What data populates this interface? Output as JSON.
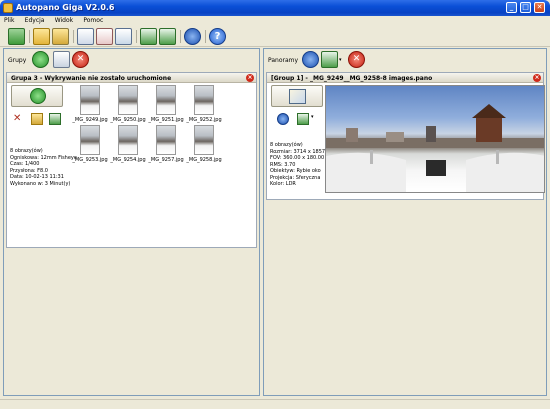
{
  "window": {
    "title": "Autopano Giga V2.0.6"
  },
  "menu": [
    "Plik",
    "Edycja",
    "Widok",
    "Pomoc"
  ],
  "toolbar": {
    "icons": [
      "new-project-icon",
      "open-folder-icon",
      "search-folder-icon",
      "group-icon-1",
      "group-icon-2",
      "group-icon-3",
      "import-icon",
      "export-icon",
      "settings-icon",
      "help-icon"
    ]
  },
  "left_panel": {
    "label": "Grupy",
    "group_title": "Grupa 3 - Wykrywanie nie zostało uruchomione",
    "thumbnails": [
      "_MG_9249.jpg",
      "_MG_9250.jpg",
      "_MG_9251.jpg",
      "_MG_9252.jpg",
      "_MG_9253.jpg",
      "_MG_9254.jpg",
      "_MG_9257.jpg",
      "_MG_9258.jpg"
    ],
    "info": [
      "8 obrazy(ów)",
      "Ogniskowa: 12mm Fisheye",
      "Czas: 1/400",
      "Przysłona: F8.0",
      "Data: 10-02-13 11:31",
      "Wykonano w: 3 Minut(y)"
    ]
  },
  "right_panel": {
    "label": "Panoramy",
    "pano_title": "[Group 1] - _MG_9249__MG_9258-8 images.pano",
    "info": [
      "8 obrazy(ów)",
      "Rozmiar: 3714 x 1857",
      "FOV: 360.00 x 180.00",
      "RMS: 3.70",
      "Obiektyw: Rybie oko",
      "Projekcja: Sferyczna",
      "Kolor: LDR"
    ]
  }
}
